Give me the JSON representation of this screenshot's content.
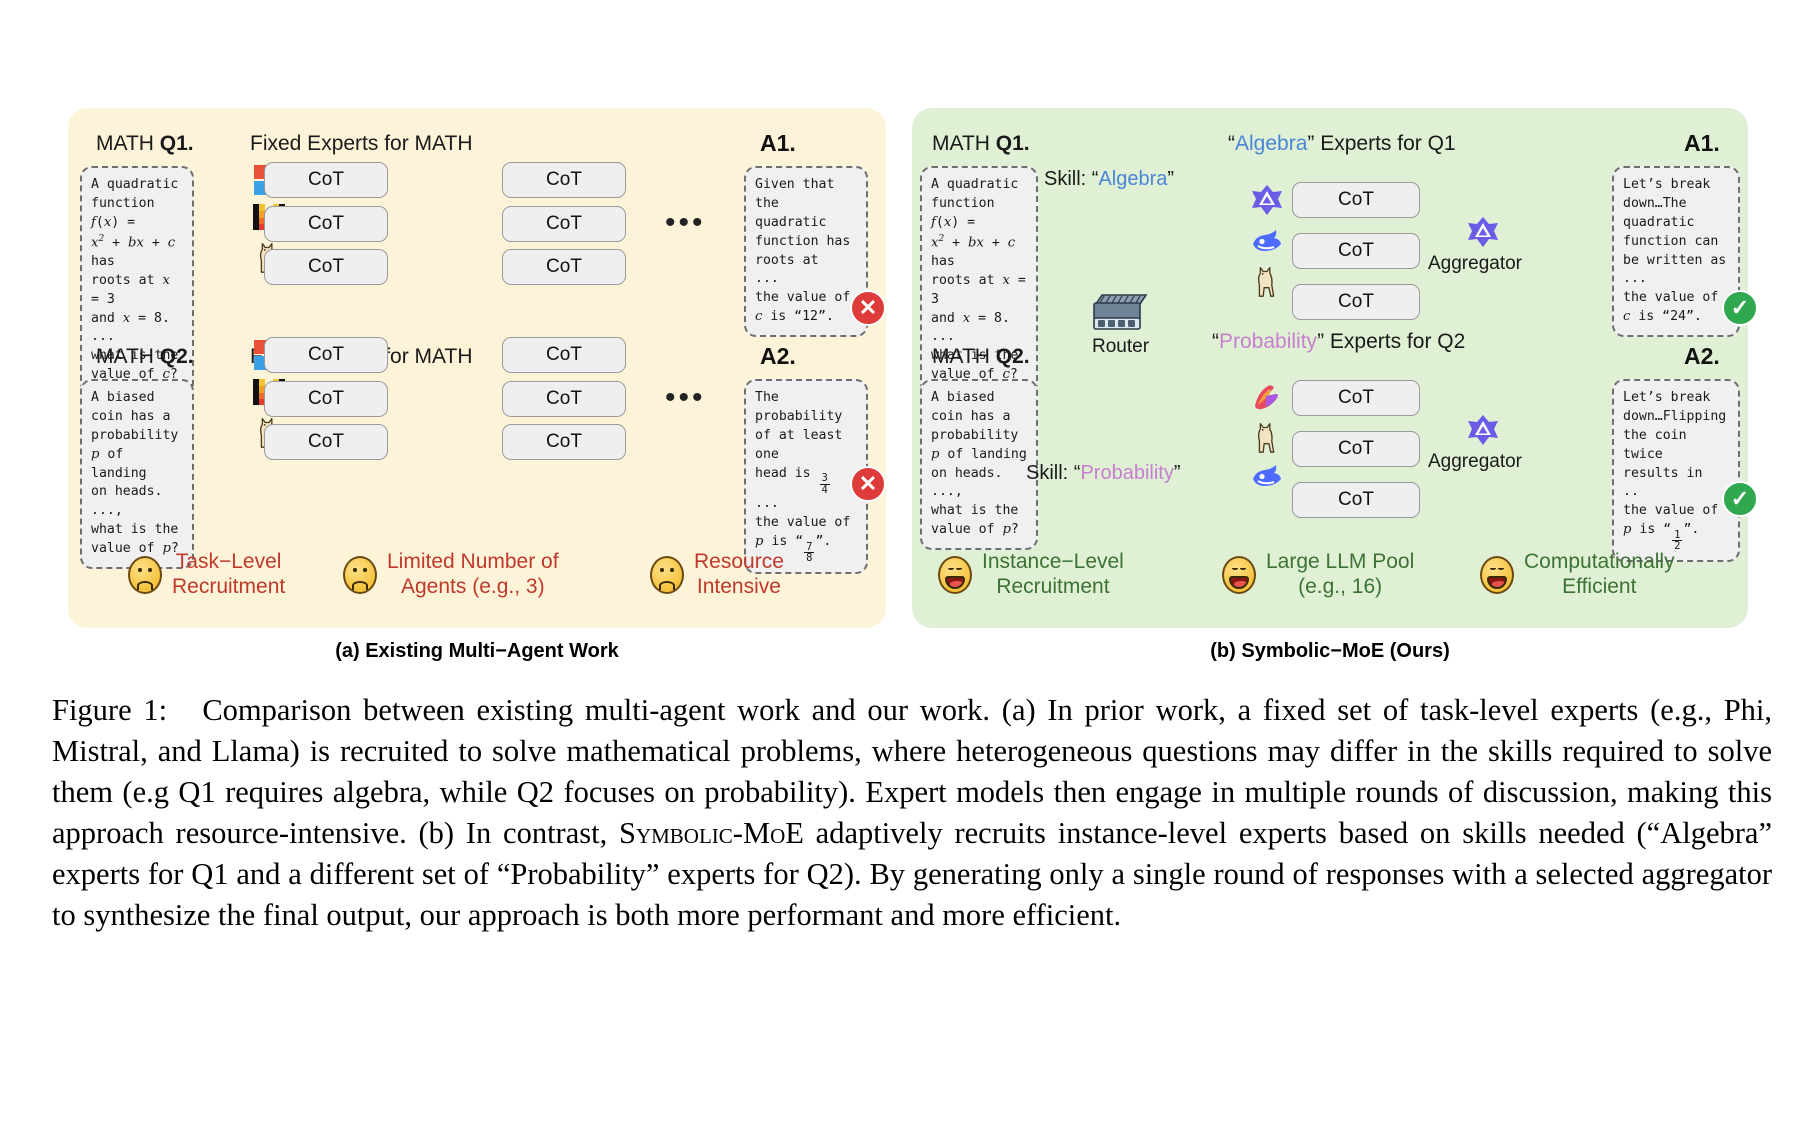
{
  "figure": {
    "label": "Figure 1:",
    "caption_html": "Comparison between existing multi-agent work and our work. (a) In prior work, a fixed set of task-level experts (e.g., Phi, Mistral, and Llama) is recruited to solve mathematical problems, where heterogeneous questions may differ in the skills required to solve them (e.g Q1 requires algebra, while Q2 focuses on probability). Expert models then engage in multiple rounds of discussion, making this approach resource-intensive. (b) In contrast, <span class=\"sc\">Symbolic-MoE</span> adaptively recruits instance-level experts based on skills needed (“Algebra” experts for Q1 and a different set of “Probability” experts for Q2). By generating only a single round of responses with a selected aggregator to synthesize the final output, our approach is both more performant and more efficient."
  },
  "panel_a": {
    "caption": "(a) Existing Multi−Agent Work",
    "bg_color": "#fdf3d8",
    "rows": [
      {
        "q_title_prefix": "MATH ",
        "q_title_bold": "Q1.",
        "experts_heading": "Fixed Experts for MATH",
        "question_lines": [
          "A quadratic",
          "function f(x) =",
          "x² + bx + c has",
          "roots at x = 3",
          "and x = 8.",
          "...",
          "what is the",
          "value of c?"
        ],
        "cot_label": "CoT",
        "cot_count": 6,
        "answer_title": "A1.",
        "answer_lines": [
          "Given that",
          "the quadratic",
          "function has",
          "roots at",
          "...",
          "the value of",
          "c is “12”."
        ],
        "status": "cross",
        "experts": [
          "phi-icon",
          "mistral-icon",
          "llama-icon"
        ]
      },
      {
        "q_title_prefix": "MATH ",
        "q_title_bold": "Q2.",
        "experts_heading": "Fixed Experts for MATH",
        "question_lines": [
          "A biased",
          "coin has a",
          "probability",
          "p of landing",
          "on heads.",
          "...,",
          "what is the",
          "value of p?"
        ],
        "cot_label": "CoT",
        "cot_count": 6,
        "answer_title": "A2.",
        "answer_lines": [
          "The probability",
          "of at least one",
          "head is 3/4",
          "...",
          "the value of",
          "p is “7/8”."
        ],
        "status": "cross",
        "experts": [
          "phi-icon",
          "mistral-icon",
          "llama-icon"
        ]
      }
    ],
    "footer": [
      {
        "face": "sad",
        "line1": "Task−Level",
        "line2": "Recruitment"
      },
      {
        "face": "sad",
        "line1": "Limited Number of",
        "line2": "Agents (e.g., 3)"
      },
      {
        "face": "sad",
        "line1": "Resource",
        "line2": "Intensive"
      }
    ]
  },
  "panel_b": {
    "caption": "(b) Symbolic−MoE (Ours)",
    "bg_color": "#dff0d4",
    "router_label": "Router",
    "aggregator_label": "Aggregator",
    "rows": [
      {
        "q_title_prefix": "MATH ",
        "q_title_bold": "Q1.",
        "skill_prefix": "Skill: ",
        "skill_name": "Algebra",
        "skill_color": "#4a86d8",
        "experts_heading_quoted": "Algebra",
        "experts_heading_rest": " Experts for Q1",
        "question_lines": [
          "A quadratic",
          "function f(x) =",
          "x² + bx + c has",
          "roots at x = 3",
          "and x = 8.",
          "...",
          "what is the",
          "value of c?"
        ],
        "cot_label": "CoT",
        "cot_count": 3,
        "answer_title": "A1.",
        "answer_lines": [
          "Let’s break",
          "down…The",
          "quadratic",
          "function can",
          "be written as",
          "...",
          "the value of",
          "c is “24”."
        ],
        "status": "check",
        "experts": [
          "gemma-icon",
          "deepseek-icon",
          "llama-icon"
        ],
        "aggregator_icon": "gemma-icon"
      },
      {
        "q_title_prefix": "MATH ",
        "q_title_bold": "Q2.",
        "skill_prefix": "Skill: ",
        "skill_name": "Probability",
        "skill_color": "#c77fd0",
        "experts_heading_quoted": "Probability",
        "experts_heading_rest": " Experts for Q2",
        "question_lines": [
          "A biased",
          "coin has a",
          "probability",
          "p of landing",
          "on heads.",
          "...,",
          "what is the",
          "value of p?"
        ],
        "cot_label": "CoT",
        "cot_count": 3,
        "answer_title": "A2.",
        "answer_lines": [
          "Let’s break",
          "down…Flipping",
          "the coin twice",
          "results in",
          "..",
          "the value of",
          "p is “1/2”."
        ],
        "status": "check",
        "experts": [
          "mistral2-icon",
          "llama-icon",
          "deepseek-icon"
        ],
        "aggregator_icon": "gemma-icon"
      }
    ],
    "footer": [
      {
        "face": "happy",
        "line1": "Instance−Level",
        "line2": "Recruitment"
      },
      {
        "face": "happy",
        "line1": "Large LLM Pool",
        "line2": "(e.g., 16)"
      },
      {
        "face": "happy",
        "line1": "Computationally",
        "line2": "Efficient"
      }
    ]
  },
  "colors": {
    "cross_badge": "#de3b3b",
    "check_badge": "#2fa84f",
    "bad_text": "#c0392b",
    "good_text": "#3d7235",
    "algebra": "#4a86d8",
    "probability": "#c77fd0"
  }
}
